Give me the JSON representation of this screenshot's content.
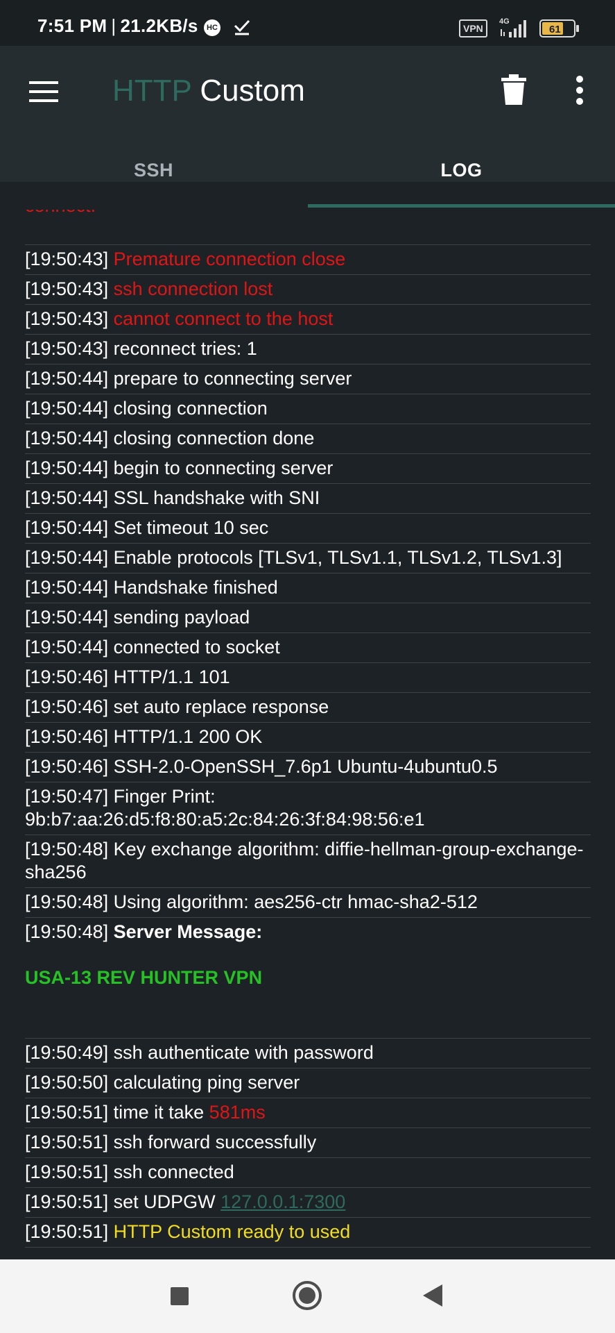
{
  "status_bar": {
    "time": "7:51 PM",
    "separator": "|",
    "speed": "21.2KB/s",
    "hc_badge": "HC",
    "vpn_badge": "VPN",
    "network_type": "4G",
    "battery": "61"
  },
  "app_bar": {
    "title_part1": "HTTP",
    "title_part2": "Custom",
    "icons": {
      "menu": "hamburger-menu",
      "delete": "trash",
      "overflow": "more-vert"
    }
  },
  "tabs": [
    {
      "label": "SSH",
      "active": false
    },
    {
      "label": "LOG",
      "active": true
    }
  ],
  "log": {
    "cut_line": "connect.",
    "entries": [
      {
        "ts": "[19:50:43]",
        "msg": "Premature connection close",
        "style": "red"
      },
      {
        "ts": "[19:50:43]",
        "msg": "ssh connection lost",
        "style": "red"
      },
      {
        "ts": "[19:50:43]",
        "msg": "cannot connect to the host",
        "style": "red"
      },
      {
        "ts": "[19:50:43]",
        "msg": "reconnect tries: 1",
        "style": "normal"
      },
      {
        "ts": "[19:50:44]",
        "msg": "prepare to connecting server",
        "style": "normal"
      },
      {
        "ts": "[19:50:44]",
        "msg": "closing connection",
        "style": "normal"
      },
      {
        "ts": "[19:50:44]",
        "msg": "closing connection done",
        "style": "normal"
      },
      {
        "ts": "[19:50:44]",
        "msg": "begin to connecting server",
        "style": "normal"
      },
      {
        "ts": "[19:50:44]",
        "msg": "SSL handshake with SNI",
        "style": "normal"
      },
      {
        "ts": "[19:50:44]",
        "msg": "Set timeout 10 sec",
        "style": "normal"
      },
      {
        "ts": "[19:50:44]",
        "msg": "Enable protocols [TLSv1, TLSv1.1, TLSv1.2, TLSv1.3]",
        "style": "normal"
      },
      {
        "ts": "[19:50:44]",
        "msg": "Handshake finished",
        "style": "normal"
      },
      {
        "ts": "[19:50:44]",
        "msg": "sending payload",
        "style": "normal"
      },
      {
        "ts": "[19:50:44]",
        "msg": "connected to socket",
        "style": "normal"
      },
      {
        "ts": "[19:50:46]",
        "msg": "HTTP/1.1 101",
        "style": "normal"
      },
      {
        "ts": "[19:50:46]",
        "msg": "set auto replace response",
        "style": "normal"
      },
      {
        "ts": "[19:50:46]",
        "msg": "HTTP/1.1 200 OK",
        "style": "normal"
      },
      {
        "ts": "[19:50:46]",
        "msg": "SSH-2.0-OpenSSH_7.6p1 Ubuntu-4ubuntu0.5",
        "style": "normal"
      },
      {
        "ts": "[19:50:47]",
        "msg": "Finger Print: 9b:b7:aa:26:d5:f8:80:a5:2c:84:26:3f:84:98:56:e1",
        "style": "normal"
      },
      {
        "ts": "[19:50:48]",
        "msg": "Key exchange algorithm: diffie-hellman-group-exchange-sha256",
        "style": "normal"
      },
      {
        "ts": "[19:50:48]",
        "msg": "Using algorithm: aes256-ctr hmac-sha2-512",
        "style": "normal"
      },
      {
        "ts": "[19:50:48]",
        "msg": "Server Message:",
        "style": "server",
        "banner": "USA-13 REV HUNTER VPN"
      },
      {
        "ts": "[19:50:49]",
        "msg": "ssh authenticate with password",
        "style": "normal"
      },
      {
        "ts": "[19:50:50]",
        "msg": "calculating ping server",
        "style": "normal"
      },
      {
        "ts": "[19:50:51]",
        "msg": "time it take ",
        "style": "normal",
        "extra": "581ms",
        "extra_style": "red"
      },
      {
        "ts": "[19:50:51]",
        "msg": "ssh forward successfully",
        "style": "normal"
      },
      {
        "ts": "[19:50:51]",
        "msg": "ssh connected",
        "style": "normal"
      },
      {
        "ts": "[19:50:51]",
        "msg": "set UDPGW ",
        "style": "normal",
        "extra": "127.0.0.1:7300",
        "extra_style": "link"
      },
      {
        "ts": "[19:50:51]",
        "msg": "HTTP Custom ready to used",
        "style": "yellow"
      }
    ]
  },
  "nav_bar": {
    "icons": [
      "recent-apps",
      "home",
      "back"
    ]
  },
  "colors": {
    "background": "#1d2226",
    "app_bar": "#252d31",
    "accent": "#2e6b5e",
    "error": "#e01515",
    "success": "#25c125",
    "ready": "#f3dd1c"
  }
}
